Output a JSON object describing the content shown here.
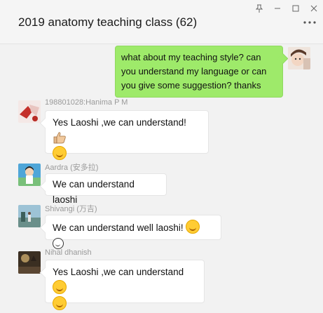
{
  "window": {
    "title": "2019 anatomy teaching class (62)",
    "controls": [
      "pin",
      "minimize",
      "maximize",
      "close"
    ]
  },
  "messages": [
    {
      "from": "me",
      "text": "what about my teaching style? can you understand my language or can you give some  suggestion? thanks"
    },
    {
      "sender": "198801028:Hanima P M",
      "text": "Yes Laoshi ,we can understand!",
      "emojis": [
        "thumbs-up",
        "smile"
      ]
    },
    {
      "sender": "Aardra (安多拉)",
      "text": "We can understand laoshi"
    },
    {
      "sender": "Shivangi (万吉)",
      "text": "We can understand well laoshi!",
      "emojis": [
        "smile",
        "smile-outline"
      ]
    },
    {
      "sender": "Nihal dhanish",
      "text": "Yes Laoshi ,we can understand",
      "emojis": [
        "blush",
        "blush"
      ]
    }
  ],
  "colors": {
    "self_bubble": "#9eea6a",
    "other_bubble": "#ffffff",
    "background": "#f2f2f2"
  }
}
